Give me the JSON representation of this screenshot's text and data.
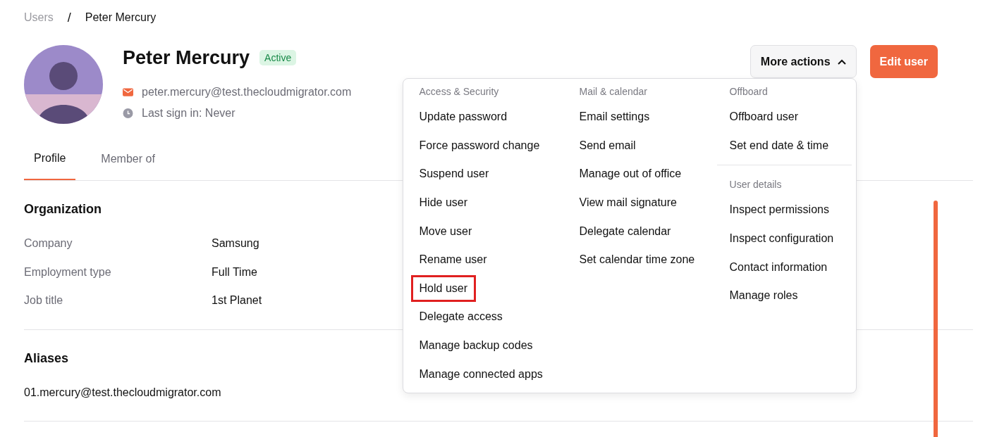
{
  "breadcrumb": [
    {
      "label": "Users",
      "current": false
    },
    {
      "label": "Peter Mercury",
      "current": true
    }
  ],
  "breadcrumb_separator": "/",
  "user": {
    "name": "Peter Mercury",
    "status": "Active",
    "email": "peter.mercury@test.thecloudmigrator.com",
    "last_sign_in": "Last sign in: Never"
  },
  "actions": [
    {
      "label": "More actions",
      "kind": "menu",
      "expanded": true
    },
    {
      "label": "Edit user",
      "kind": "primary"
    }
  ],
  "menu": {
    "columns": [
      {
        "sections": [
          {
            "heading": "Access & Security",
            "items": [
              {
                "label": "Update password",
                "highlighted": false
              },
              {
                "label": "Force password change",
                "highlighted": false
              },
              {
                "label": "Suspend user",
                "highlighted": false
              },
              {
                "label": "Hide user",
                "highlighted": false
              },
              {
                "label": "Move user",
                "highlighted": false
              },
              {
                "label": "Rename user",
                "highlighted": false
              },
              {
                "label": "Hold user",
                "highlighted": true
              },
              {
                "label": "Delegate access",
                "highlighted": false
              },
              {
                "label": "Manage backup codes",
                "highlighted": false
              },
              {
                "label": "Manage connected apps",
                "highlighted": false
              }
            ]
          }
        ]
      },
      {
        "sections": [
          {
            "heading": "Mail & calendar",
            "items": [
              {
                "label": "Email settings",
                "highlighted": false
              },
              {
                "label": "Send email",
                "highlighted": false
              },
              {
                "label": "Manage out of office",
                "highlighted": false
              },
              {
                "label": "View mail signature",
                "highlighted": false
              },
              {
                "label": "Delegate calendar",
                "highlighted": false
              },
              {
                "label": "Set calendar time zone",
                "highlighted": false
              }
            ]
          }
        ]
      },
      {
        "sections": [
          {
            "heading": "Offboard",
            "items": [
              {
                "label": "Offboard user",
                "highlighted": false
              },
              {
                "label": "Set end date & time",
                "highlighted": false
              }
            ]
          },
          {
            "heading": "User details",
            "items": [
              {
                "label": "Inspect permissions",
                "highlighted": false
              },
              {
                "label": "Inspect configuration",
                "highlighted": false
              },
              {
                "label": "Contact information",
                "highlighted": false
              },
              {
                "label": "Manage roles",
                "highlighted": false
              }
            ]
          }
        ]
      }
    ]
  },
  "tabs": [
    {
      "label": "Profile",
      "selected": true
    },
    {
      "label": "Member of",
      "selected": false
    }
  ],
  "sections": [
    {
      "title": "Organization",
      "kind": "fields",
      "fields": [
        {
          "label": "Company",
          "value": "Samsung"
        },
        {
          "label": "Employment type",
          "value": "Full Time"
        },
        {
          "label": "Job title",
          "value": "1st Planet"
        }
      ]
    },
    {
      "title": "Aliases",
      "kind": "list",
      "items": [
        "01.mercury@test.thecloudmigrator.com"
      ]
    }
  ]
}
